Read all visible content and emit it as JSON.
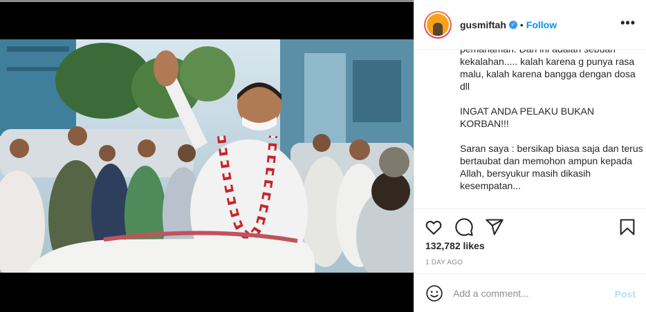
{
  "post": {
    "username": "gusmiftah",
    "follow_label": "Follow",
    "separator": "•",
    "more_label": "•••",
    "caption_lines": [
      "pemahaman. Dan ini adalah sebuah kekalahan..... kalah karena g punya rasa malu, kalah karena bangga dengan dosa dll",
      "INGAT ANDA PELAKU BUKAN KORBAN!!!",
      "Saran saya : bersikap biasa saja dan terus bertaubat dan memohon ampun kepada Allah, bersyukur masih dikasih kesempatan..."
    ],
    "likes": "132,782 likes",
    "time_ago": "1 DAY AGO",
    "comment_placeholder": "Add a comment...",
    "post_label": "Post"
  },
  "icons": {
    "like": "heart-icon",
    "comment": "comment-icon",
    "share": "share-icon",
    "save": "bookmark-icon",
    "emoji": "emoji-icon",
    "verified": "verified-badge-icon"
  },
  "colors": {
    "accent": "#0095f6",
    "post_disabled": "#b2dffc",
    "text": "#262626",
    "muted": "#8e8e8e"
  }
}
